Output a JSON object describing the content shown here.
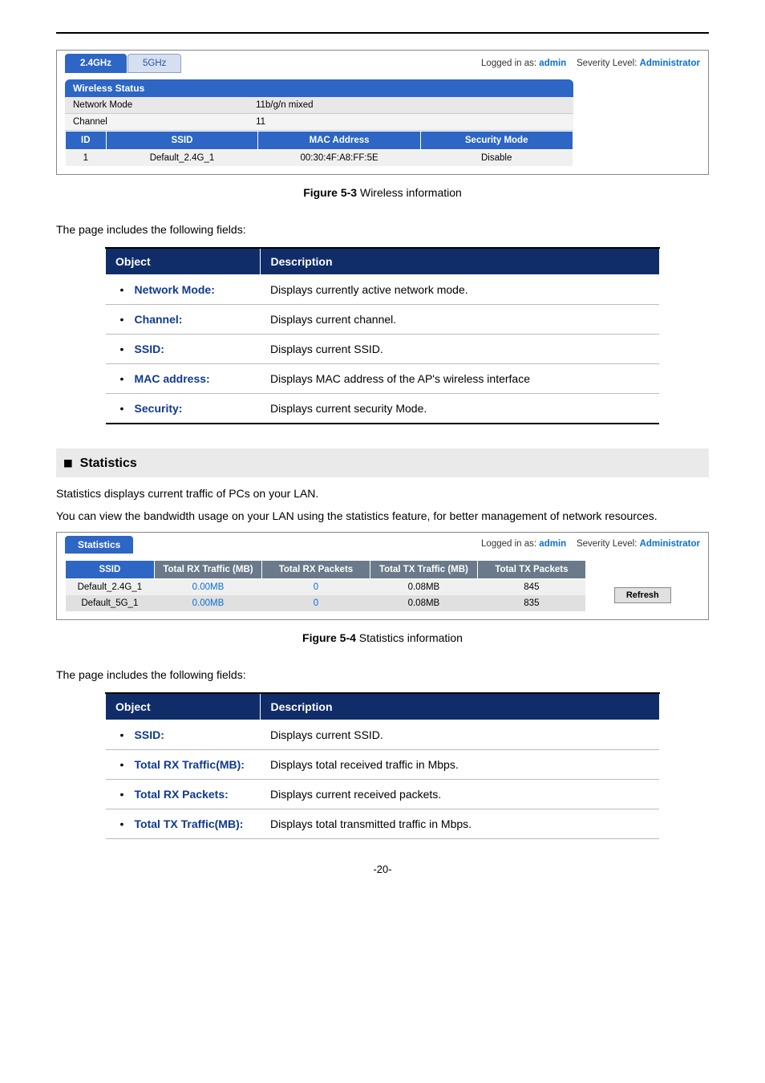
{
  "page_number": "-20-",
  "login_bar": {
    "logged_in_as": "Logged in as:",
    "user": "admin",
    "sev_label": "Severity Level:",
    "sev_value": "Administrator"
  },
  "wireless_panel": {
    "tabs": [
      "2.4GHz",
      "5GHz"
    ],
    "active_tab": 0,
    "section_title": "Wireless Status",
    "rows": [
      {
        "label": "Network Mode",
        "value": "11b/g/n mixed"
      },
      {
        "label": "Channel",
        "value": "11"
      }
    ],
    "columns": [
      "ID",
      "SSID",
      "MAC Address",
      "Security Mode"
    ],
    "data": [
      {
        "id": "1",
        "ssid": "Default_2.4G_1",
        "mac": "00:30:4F:A8:FF:5E",
        "security": "Disable"
      }
    ]
  },
  "figure1": {
    "label": "Figure 5-3",
    "text": " Wireless information"
  },
  "intro1": "The page includes the following fields:",
  "desc_table1": {
    "headers": [
      "Object",
      "Description"
    ],
    "rows": [
      {
        "obj": "Network Mode:",
        "desc": "Displays currently active network mode."
      },
      {
        "obj": "Channel:",
        "desc": "Displays current channel."
      },
      {
        "obj": "SSID:",
        "desc": "Displays current SSID."
      },
      {
        "obj": "MAC address:",
        "desc": "Displays MAC address of the AP's wireless interface"
      },
      {
        "obj": "Security:",
        "desc": "Displays current security Mode."
      }
    ]
  },
  "stats_heading": "Statistics",
  "stats_p1": "Statistics displays current traffic of PCs on your LAN.",
  "stats_p2": "You can view the bandwidth usage on your LAN using the statistics feature, for better management of network resources.",
  "stats_panel": {
    "section_title": "Statistics",
    "columns": [
      "SSID",
      "Total RX Traffic (MB)",
      "Total RX Packets",
      "Total TX Traffic (MB)",
      "Total TX Packets"
    ],
    "rows": [
      {
        "ssid": "Default_2.4G_1",
        "rx_mb": "0.00MB",
        "rx_p": "0",
        "tx_mb": "0.08MB",
        "tx_p": "845"
      },
      {
        "ssid": "Default_5G_1",
        "rx_mb": "0.00MB",
        "rx_p": "0",
        "tx_mb": "0.08MB",
        "tx_p": "835"
      }
    ],
    "refresh_label": "Refresh"
  },
  "figure2": {
    "label": "Figure 5-4",
    "text": " Statistics information"
  },
  "intro2": "The page includes the following fields:",
  "desc_table2": {
    "headers": [
      "Object",
      "Description"
    ],
    "rows": [
      {
        "obj": "SSID:",
        "desc": "Displays current SSID."
      },
      {
        "obj": "Total RX Traffic(MB):",
        "desc": "Displays total received traffic in Mbps."
      },
      {
        "obj": "Total RX Packets:",
        "desc": "Displays current received packets."
      },
      {
        "obj": "Total TX Traffic(MB):",
        "desc": "Displays total transmitted traffic in Mbps."
      }
    ]
  }
}
